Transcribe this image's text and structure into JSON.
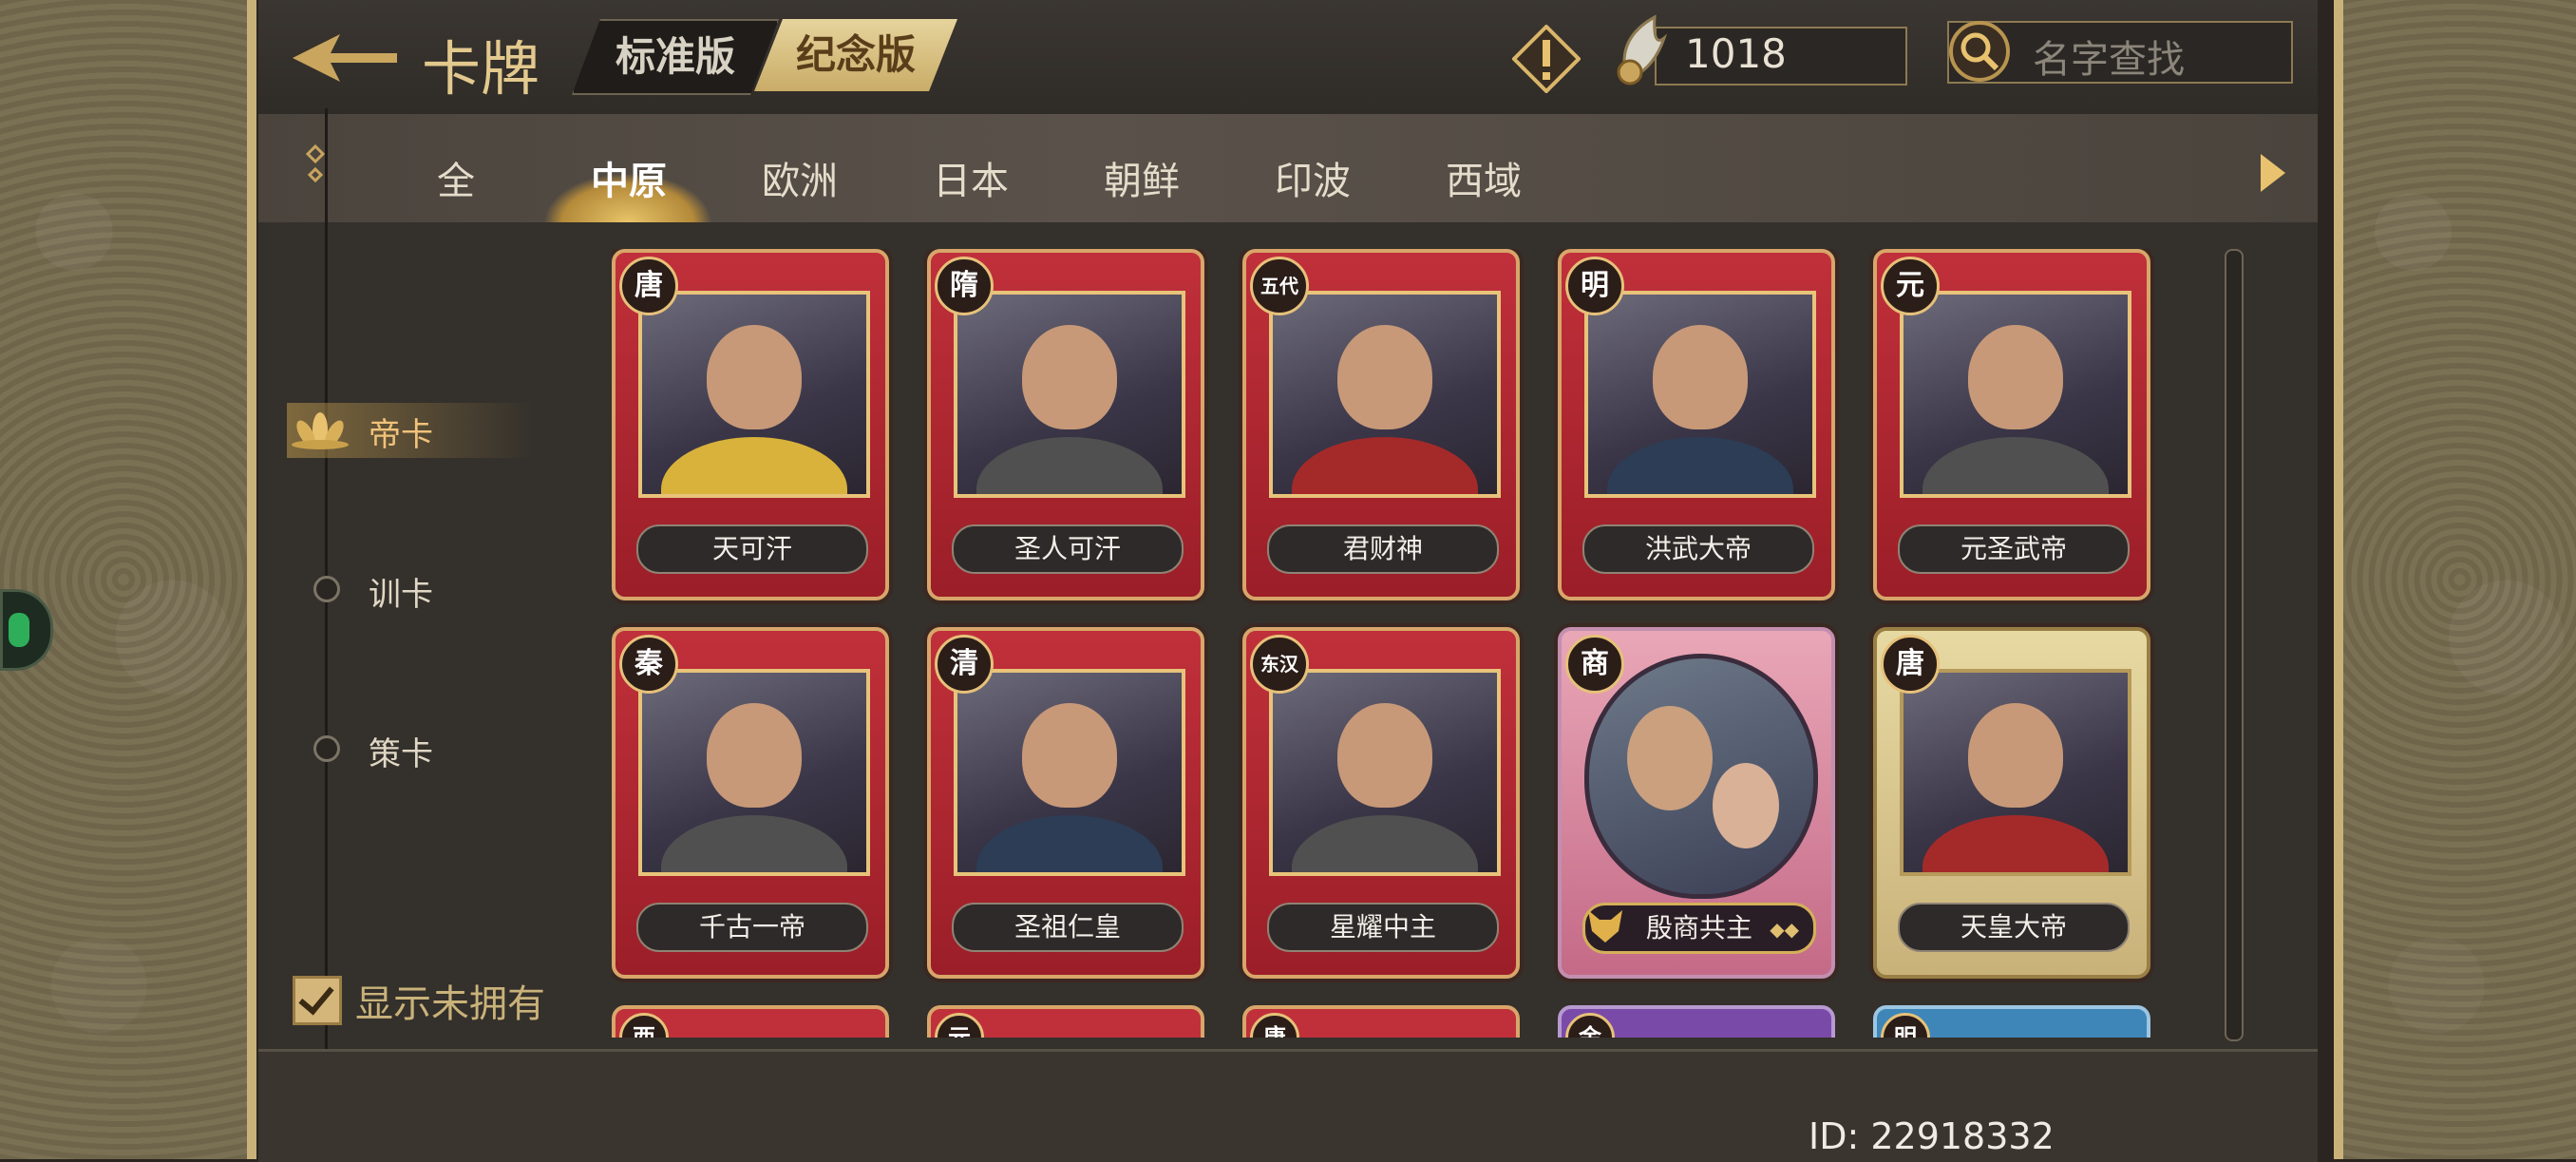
{
  "header": {
    "title": "卡牌",
    "edition_tabs": [
      "标准版",
      "纪念版"
    ],
    "active_edition": "纪念版",
    "currency_value": "1018",
    "search_placeholder": "名字查找"
  },
  "region_tabs": [
    "全",
    "中原",
    "欧洲",
    "日本",
    "朝鲜",
    "印波",
    "西域"
  ],
  "active_region": "中原",
  "sidebar": {
    "items": [
      "帝卡",
      "训卡",
      "策卡"
    ],
    "active": "帝卡",
    "show_unowned_label": "显示未拥有",
    "show_unowned_checked": true
  },
  "cards": [
    {
      "dynasty": "唐",
      "name": "天可汗",
      "style": "red"
    },
    {
      "dynasty": "隋",
      "name": "圣人可汗",
      "style": "red"
    },
    {
      "dynasty": "五代",
      "name": "君财神",
      "style": "red"
    },
    {
      "dynasty": "明",
      "name": "洪武大帝",
      "style": "red"
    },
    {
      "dynasty": "元",
      "name": "元圣武帝",
      "style": "red"
    },
    {
      "dynasty": "秦",
      "name": "千古一帝",
      "style": "red"
    },
    {
      "dynasty": "清",
      "name": "圣祖仁皇",
      "style": "red"
    },
    {
      "dynasty": "东汉",
      "name": "星耀中主",
      "style": "red"
    },
    {
      "dynasty": "商",
      "name": "殷商共主",
      "style": "pink"
    },
    {
      "dynasty": "唐",
      "name": "天皇大帝",
      "style": "gold"
    }
  ],
  "partial_row_badges": [
    "西",
    "元",
    "唐",
    "金",
    "明"
  ],
  "footer": {
    "uid": "ID: 22918332"
  }
}
